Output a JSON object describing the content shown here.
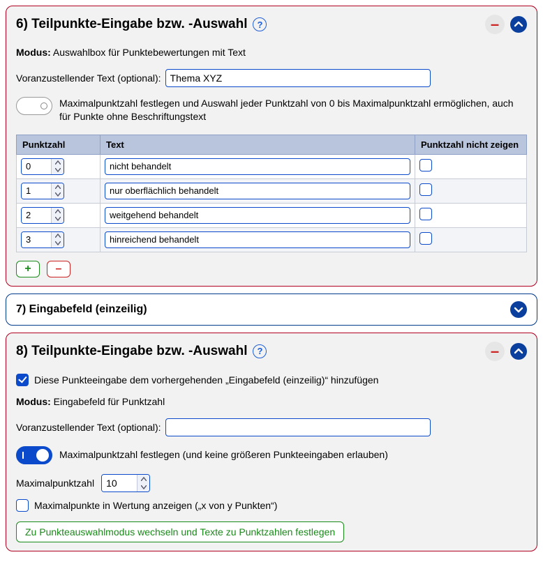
{
  "panel6": {
    "title": "6) Teilpunkte-Eingabe bzw. -Auswahl",
    "mode_label": "Modus:",
    "mode_value": "Auswahlbox für Punktebewertungen mit Text",
    "prefix_label": "Voranzustellender Text (optional):",
    "prefix_value": "Thema XYZ",
    "toggle_on": false,
    "toggle_text": "Maximalpunktzahl festlegen und Auswahl jeder Punktzahl von 0 bis Maximalpunktzahl ermöglichen, auch für Punkte ohne Beschriftungstext",
    "table": {
      "head_points": "Punktzahl",
      "head_text": "Text",
      "head_hide": "Punktzahl nicht zeigen",
      "rows": [
        {
          "points": "0",
          "text": "nicht behandelt",
          "hide": false
        },
        {
          "points": "1",
          "text": "nur oberflächlich behandelt",
          "hide": false
        },
        {
          "points": "2",
          "text": "weitgehend behandelt",
          "hide": false
        },
        {
          "points": "3",
          "text": "hinreichend behandelt",
          "hide": false
        }
      ]
    },
    "add_label": "+",
    "del_label": "–"
  },
  "panel7": {
    "title": "7) Eingabefeld (einzeilig)"
  },
  "panel8": {
    "title": "8) Teilpunkte-Eingabe bzw. -Auswahl",
    "attach_checked": true,
    "attach_text": "Diese Punkteeingabe dem vorhergehenden „Eingabefeld (einzeilig)“ hinzufügen",
    "mode_label": "Modus:",
    "mode_value": "Eingabefeld für Punktzahl",
    "prefix_label": "Voranzustellender Text (optional):",
    "prefix_value": "",
    "toggle_on": true,
    "toggle_text": "Maximalpunktzahl festlegen (und keine größeren Punkteeingaben erlauben)",
    "max_label": "Maximalpunktzahl",
    "max_value": "10",
    "showmax_checked": false,
    "showmax_text": "Maximalpunkte in Wertung anzeigen („x von y Punkten“)",
    "switch_btn": "Zu Punkteauswahlmodus wechseln und Texte zu Punktzahlen festlegen"
  }
}
